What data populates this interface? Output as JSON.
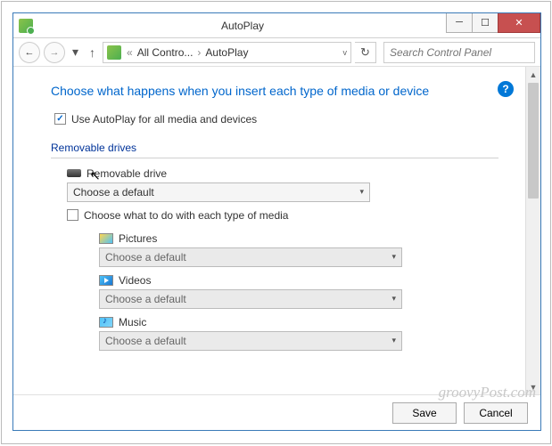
{
  "window": {
    "title": "AutoPlay"
  },
  "nav": {
    "breadcrumb_root": "All Contro...",
    "breadcrumb_leaf": "AutoPlay",
    "search_placeholder": "Search Control Panel"
  },
  "main": {
    "heading": "Choose what happens when you insert each type of media or device",
    "help_symbol": "?",
    "use_autoplay_label": "Use AutoPlay for all media and devices",
    "section_removable": "Removable drives",
    "item_removable_drive": "Removable drive",
    "combo_default": "Choose a default",
    "choose_each_type_label": "Choose what to do with each type of media",
    "item_pictures": "Pictures",
    "item_videos": "Videos",
    "item_music": "Music"
  },
  "footer": {
    "save": "Save",
    "cancel": "Cancel"
  },
  "watermark": "groovyPost.com"
}
